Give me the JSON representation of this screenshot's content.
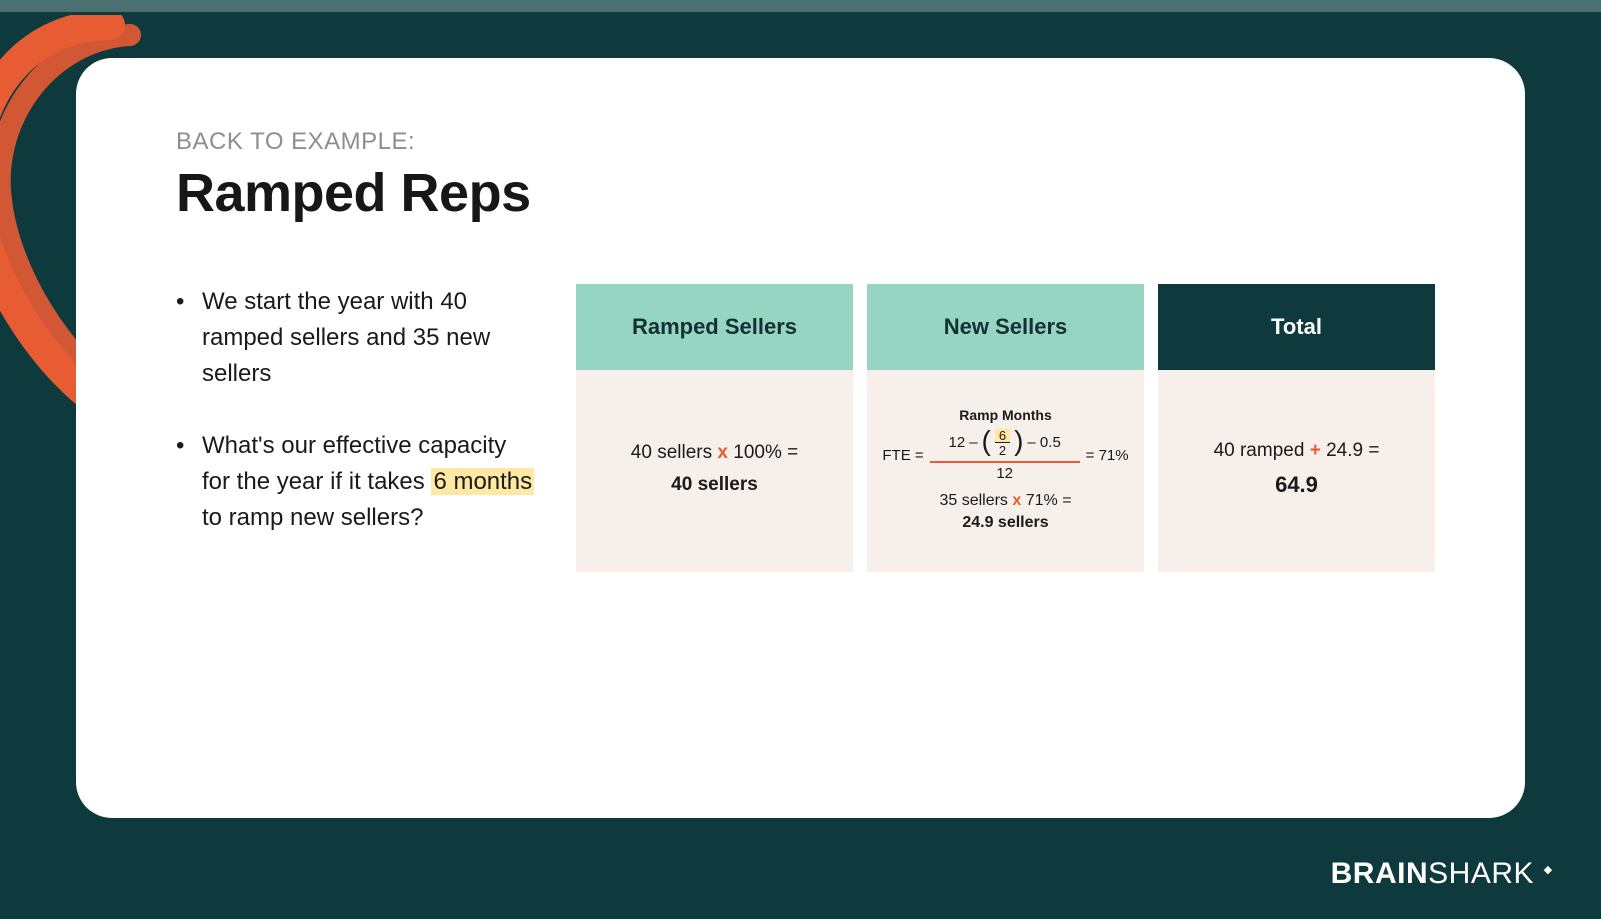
{
  "kicker": "BACK TO EXAMPLE:",
  "title": "Ramped Reps",
  "bullets": {
    "b1": "We start the year with 40 ramped sellers and 35 new sellers",
    "b2_pre": "What's our effective capacity for the year if it takes ",
    "b2_hl": "6 months",
    "b2_post": " to ramp new sellers?"
  },
  "boxes": {
    "ramped": {
      "head": "Ramped Sellers",
      "line1_a": "40 sellers ",
      "line1_op": "x",
      "line1_b": " 100% =",
      "result": "40 sellers"
    },
    "new": {
      "head": "New Sellers",
      "ramp_label": "Ramp Months",
      "fte_label": "FTE =",
      "top_12": "12",
      "minus": "–",
      "frac_n": "6",
      "frac_d": "2",
      "minus05": "– 0.5",
      "denom_12": "12",
      "eq_71": "= 71%",
      "sellers_a": "35 sellers ",
      "sellers_op": "x",
      "sellers_b": " 71% =",
      "sellers_res": "24.9 sellers"
    },
    "total": {
      "head": "Total",
      "line1_a": "40 ramped ",
      "line1_op": "+",
      "line1_b": " 24.9 =",
      "result": "64.9"
    }
  },
  "brand": {
    "bold": "BRAIN",
    "light": "SHARK"
  }
}
